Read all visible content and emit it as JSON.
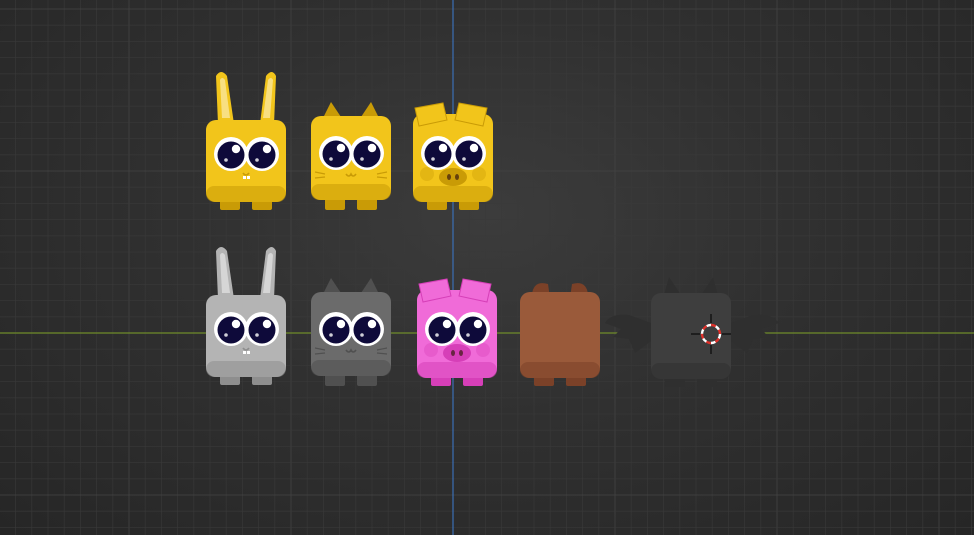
{
  "viewport": {
    "background": "#2e2e2e",
    "grid_color": "#3a3a3a",
    "x_axis_color": "#6f8c2a",
    "y_axis_color": "#3b6fb5",
    "cursor_icon": "3d-cursor-icon"
  },
  "characters": [
    {
      "name": "yellow-bunny",
      "species": "bunny",
      "color": "#f2c51b",
      "dark": "#c99b06",
      "eyes": true
    },
    {
      "name": "yellow-cat",
      "species": "cat",
      "color": "#f2c51b",
      "dark": "#c99b06",
      "eyes": true
    },
    {
      "name": "yellow-pig",
      "species": "pig",
      "color": "#f2c51b",
      "dark": "#c99b06",
      "eyes": true
    },
    {
      "name": "gray-bunny",
      "species": "bunny",
      "color": "#b4b4b4",
      "dark": "#8e8e8e",
      "eyes": true
    },
    {
      "name": "gray-cat",
      "species": "cat",
      "color": "#6b6b6b",
      "dark": "#505050",
      "eyes": true
    },
    {
      "name": "pink-pig",
      "species": "pig",
      "color": "#f06bd8",
      "dark": "#d63fb8",
      "eyes": true
    },
    {
      "name": "brown-bear",
      "species": "bear",
      "color": "#9a5a3a",
      "dark": "#7b4128",
      "eyes": false
    },
    {
      "name": "dark-bat",
      "species": "bat",
      "color": "#3e3e3e",
      "dark": "#2f2f2f",
      "eyes": false
    }
  ]
}
